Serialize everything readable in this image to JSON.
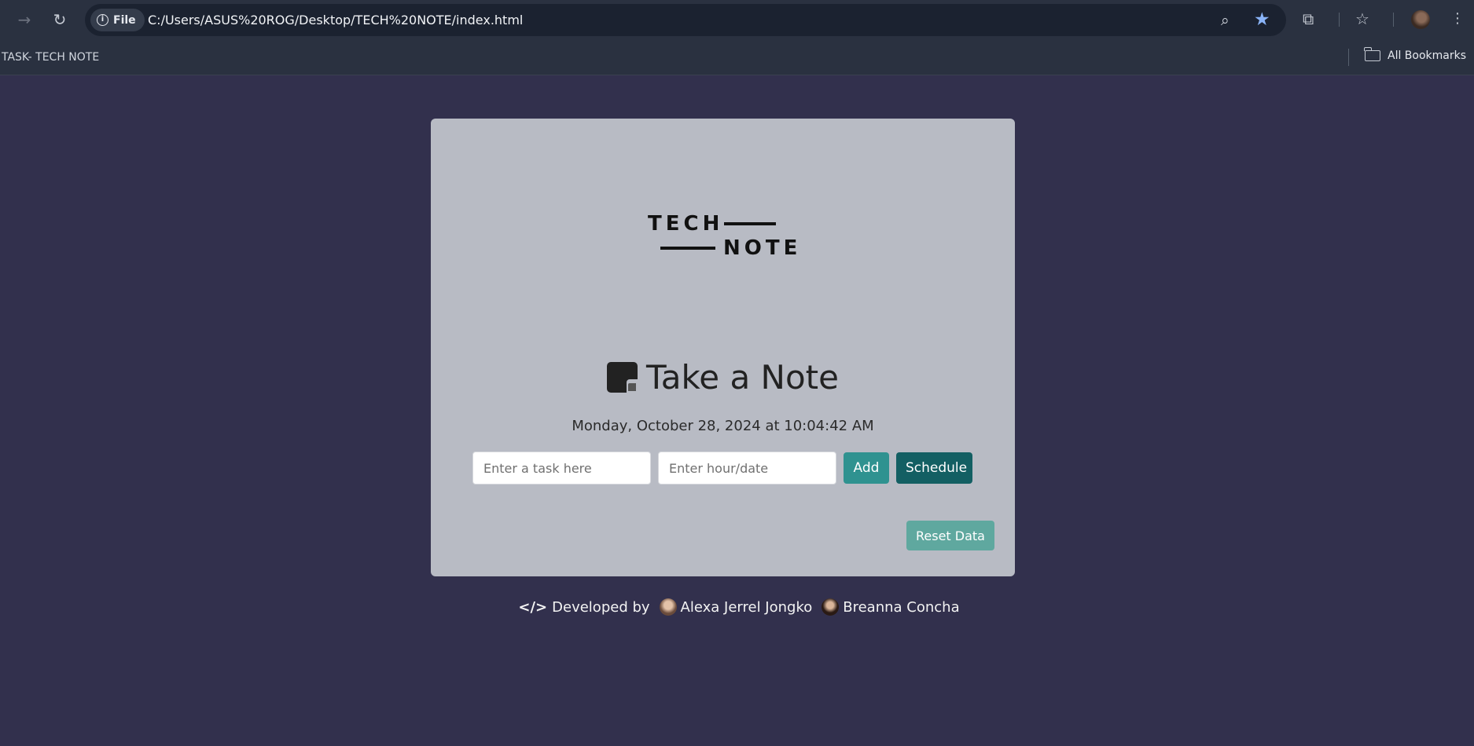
{
  "browser": {
    "url": "C:/Users/ASUS%20ROG/Desktop/TECH%20NOTE/index.html",
    "site_chip_label": "File",
    "bookmark_tab_label": "TASK- TECH NOTE",
    "all_bookmarks_label": "All Bookmarks"
  },
  "logo": {
    "word_top": "TECH",
    "word_bottom": "NOTE"
  },
  "app": {
    "heading": "Take a Note",
    "datetime": "Monday, October 28, 2024 at 10:04:42 AM",
    "task_placeholder": "Enter a task here",
    "date_placeholder": "Enter hour/date",
    "add_label": "Add",
    "schedule_label": "Schedule",
    "reset_label": "Reset Data"
  },
  "footer": {
    "developed_by": "Developed by",
    "developer_1": "Alexa Jerrel Jongko",
    "developer_2": "Breanna Concha"
  },
  "icons": {
    "forward": "arrow-right-icon",
    "reload": "reload-icon",
    "info": "info-icon",
    "zoom": "zoom-icon",
    "bookmark_star": "star-filled-icon",
    "extensions": "puzzle-icon",
    "bookmarks": "star-outline-icon",
    "menu": "more-vert-icon",
    "folder": "folder-icon",
    "note": "sticky-note-icon",
    "code": "code-icon"
  },
  "colors": {
    "page_background": "#32304d",
    "card_background": "#b8bbc4",
    "add_button": "#2f9290",
    "schedule_button": "#135f63",
    "reset_button": "#5fa89f",
    "bookmark_star": "#8ab4f8"
  }
}
